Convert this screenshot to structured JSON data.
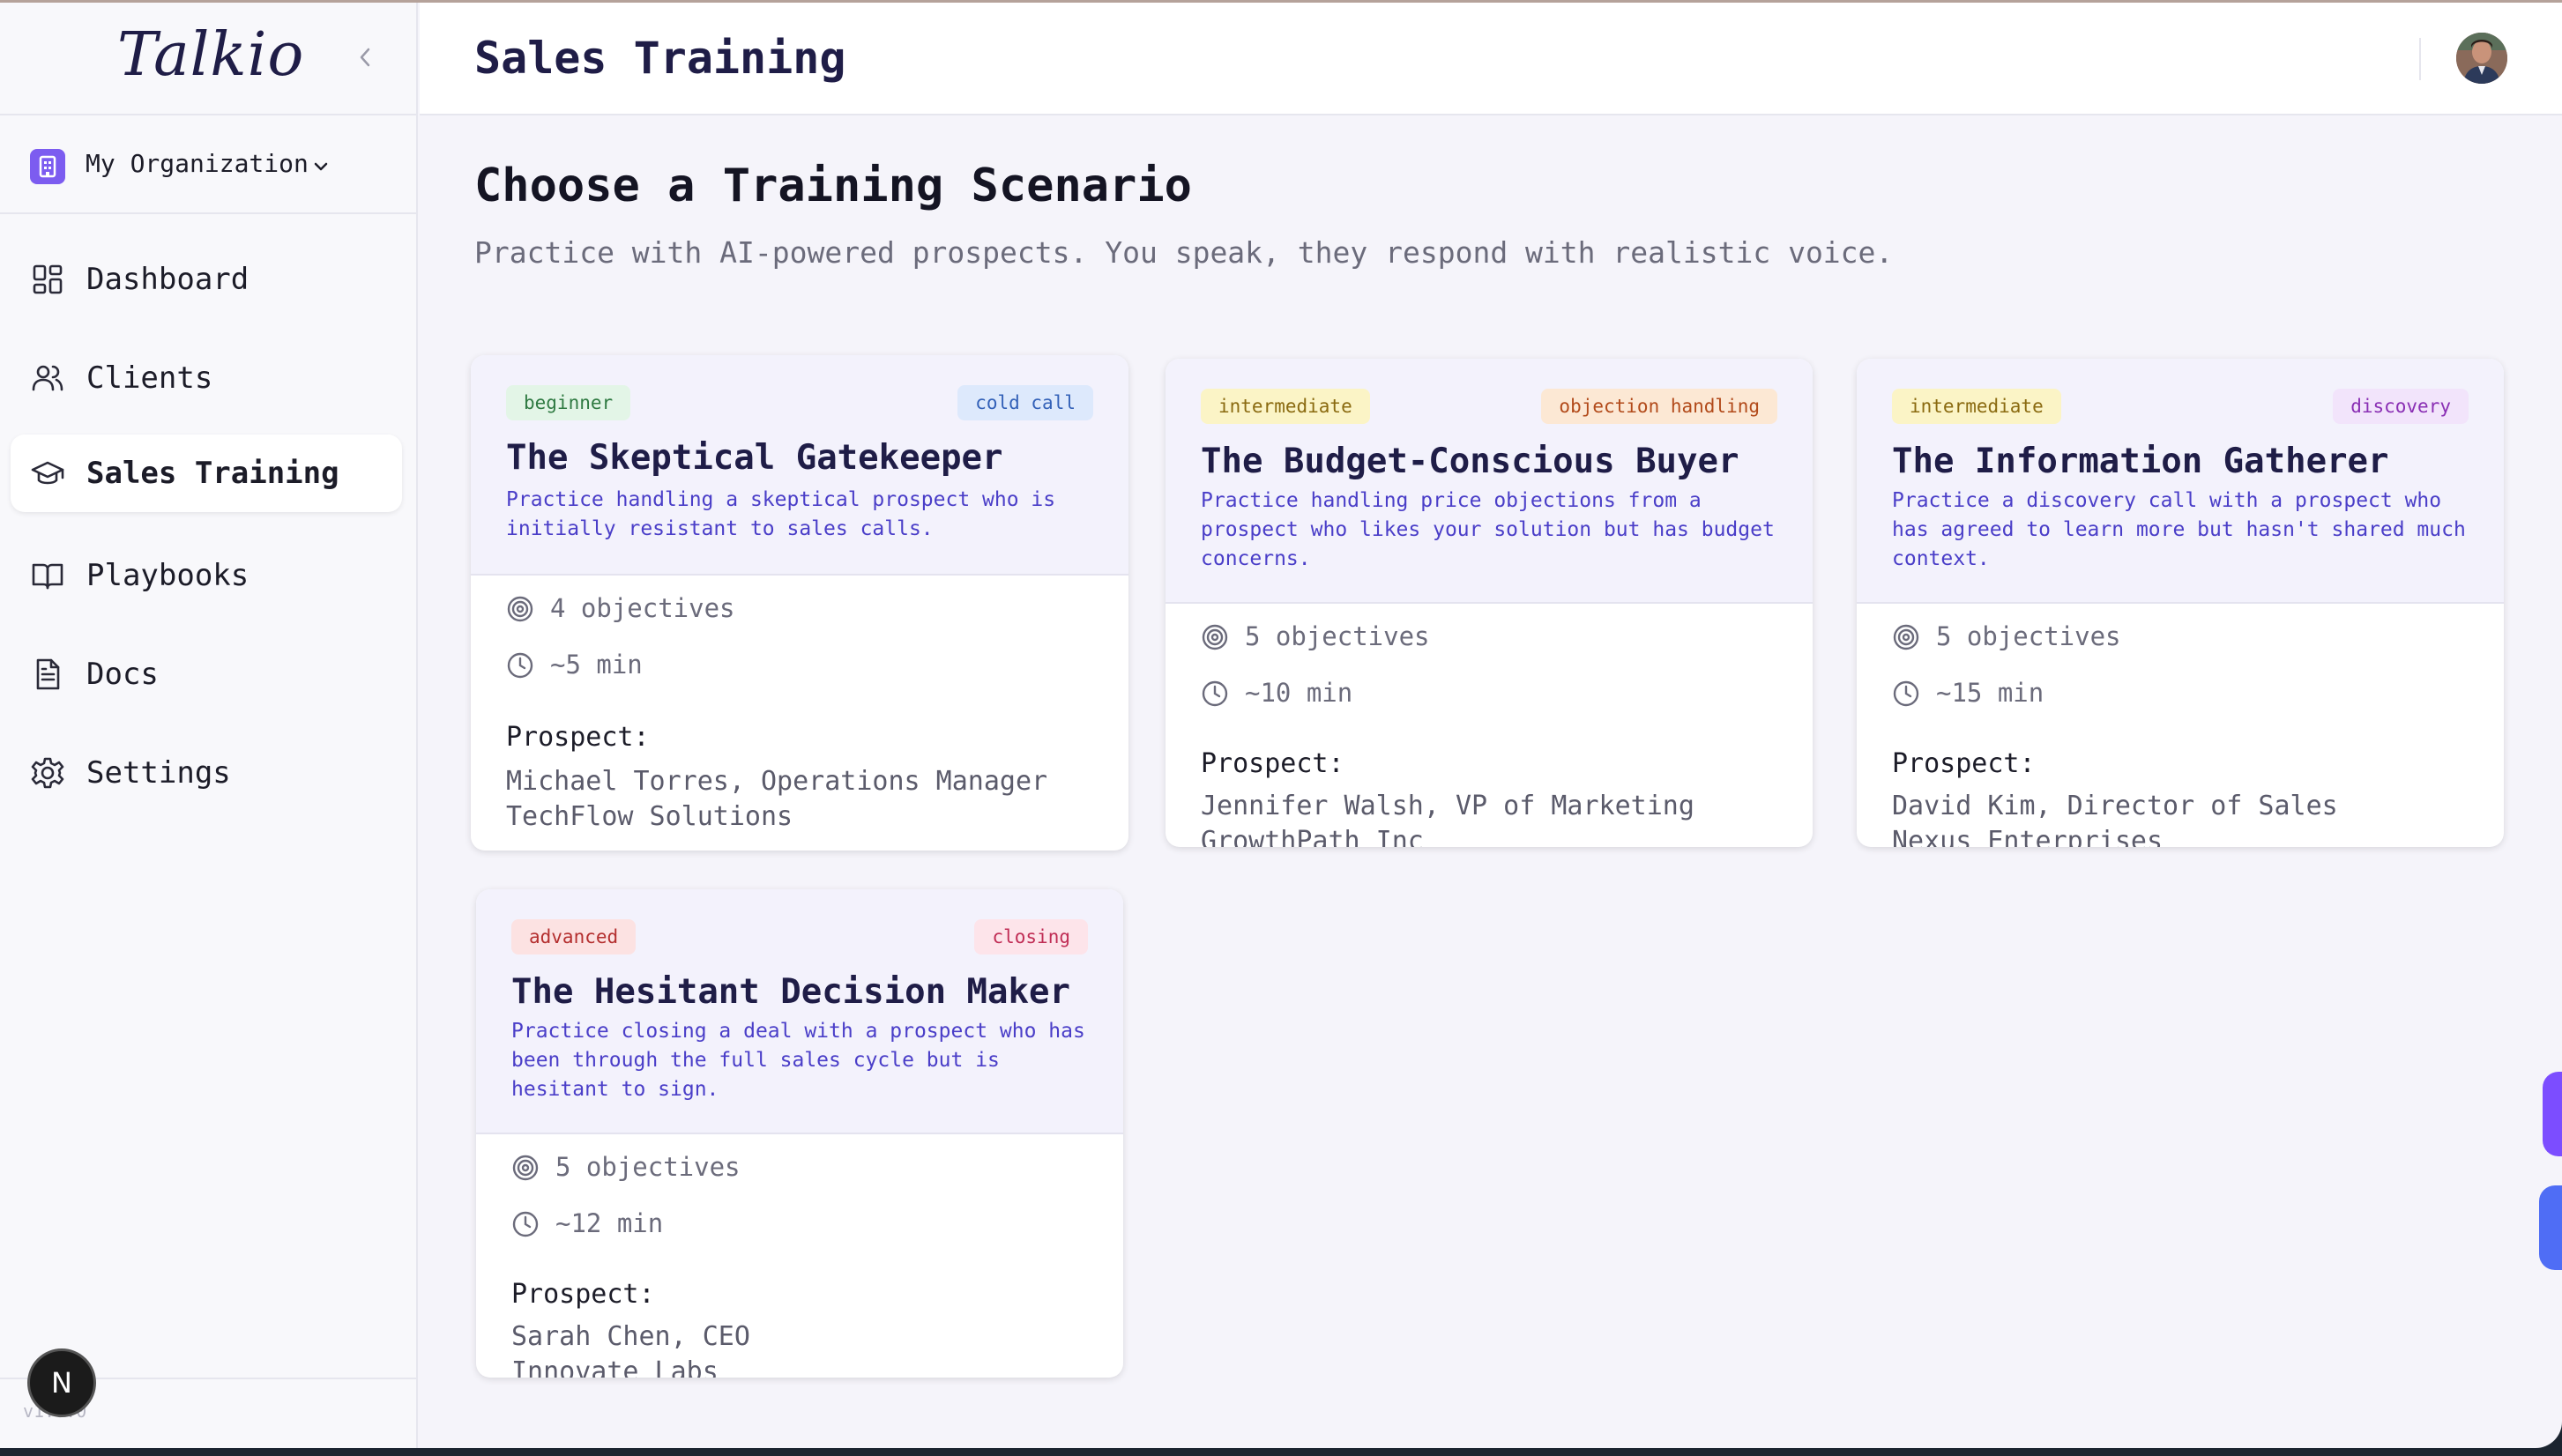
{
  "sidebar": {
    "brand": "Talkio",
    "org_label": "My Organization",
    "items": [
      {
        "label": "Dashboard",
        "icon": "dashboard-icon"
      },
      {
        "label": "Clients",
        "icon": "users-icon"
      },
      {
        "label": "Sales Training",
        "icon": "graduation-cap-icon"
      },
      {
        "label": "Playbooks",
        "icon": "book-open-icon"
      },
      {
        "label": "Docs",
        "icon": "file-text-icon"
      },
      {
        "label": "Settings",
        "icon": "gear-icon"
      }
    ],
    "active_item": "Sales Training",
    "version": "v1.0.0",
    "dev_badge": "N"
  },
  "header": {
    "title": "Sales Training"
  },
  "main": {
    "heading": "Choose a Training Scenario",
    "subheading": "Practice with AI-powered prospects. You speak, they respond with realistic voice.",
    "prospect_label": "Prospect:",
    "cards": [
      {
        "level": "beginner",
        "category": "cold call",
        "title": "The Skeptical Gatekeeper",
        "description": "Practice handling a skeptical prospect who is initially resistant to sales calls.",
        "objectives": "4 objectives",
        "duration": "~5 min",
        "prospect_name": "Michael Torres, Operations Manager",
        "prospect_company": "TechFlow Solutions"
      },
      {
        "level": "intermediate",
        "category": "objection handling",
        "title": "The Budget-Conscious Buyer",
        "description": "Practice handling price objections from a prospect who likes your solution but has budget concerns.",
        "objectives": "5 objectives",
        "duration": "~10 min",
        "prospect_name": "Jennifer Walsh, VP of Marketing",
        "prospect_company": "GrowthPath Inc"
      },
      {
        "level": "intermediate",
        "category": "discovery",
        "title": "The Information Gatherer",
        "description": "Practice a discovery call with a prospect who has agreed to learn more but hasn't shared much context.",
        "objectives": "5 objectives",
        "duration": "~15 min",
        "prospect_name": "David Kim, Director of Sales",
        "prospect_company": "Nexus Enterprises"
      },
      {
        "level": "advanced",
        "category": "closing",
        "title": "The Hesitant Decision Maker",
        "description": "Practice closing a deal with a prospect who has been through the full sales cycle but is hesitant to sign.",
        "objectives": "5 objectives",
        "duration": "~12 min",
        "prospect_name": "Sarah Chen, CEO",
        "prospect_company": "Innovate Labs"
      }
    ]
  },
  "colors": {
    "accent": "#4a3ec8",
    "beginner": "#e6f6ea",
    "intermediate": "#fdf6c8",
    "advanced": "#fde4e4",
    "cold_call": "#dceafd",
    "objection_handling": "#fde9d6",
    "discovery": "#f3e6fc",
    "closing": "#fde6ec"
  }
}
